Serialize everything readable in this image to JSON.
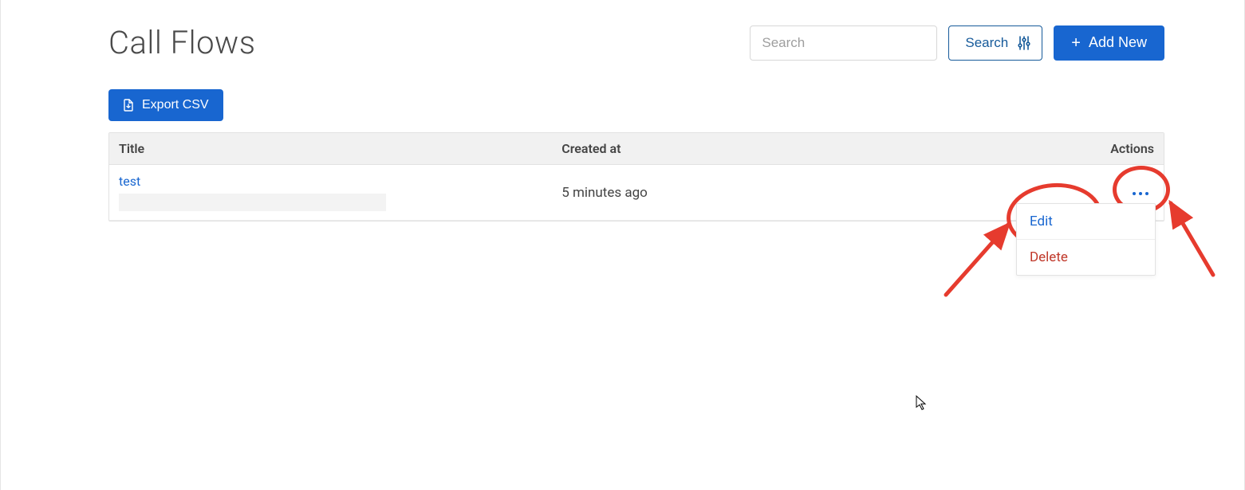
{
  "header": {
    "title": "Call Flows",
    "search_placeholder": "Search",
    "search_button_label": "Search",
    "add_button_label": "Add New"
  },
  "toolbar": {
    "export_label": "Export CSV"
  },
  "table": {
    "columns": {
      "title": "Title",
      "created_at": "Created at",
      "actions": "Actions"
    },
    "rows": [
      {
        "title": "test",
        "created_at": "5 minutes ago"
      }
    ]
  },
  "actions_menu": {
    "edit": "Edit",
    "delete": "Delete"
  }
}
